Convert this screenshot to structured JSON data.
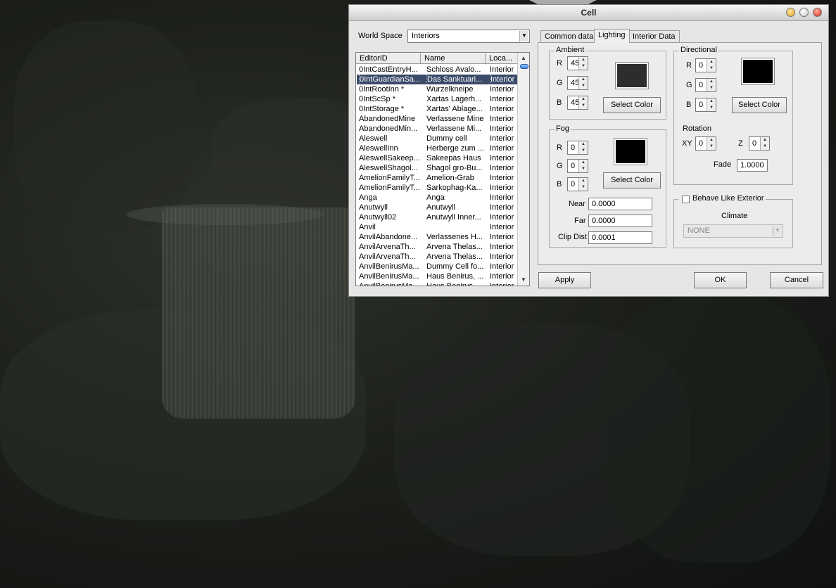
{
  "window": {
    "title": "Cell"
  },
  "worldspace": {
    "label": "World Space",
    "value": "Interiors"
  },
  "list": {
    "columns": [
      "EditorID",
      "Name",
      "Loca..."
    ],
    "rows": [
      [
        "0IntCastEntryH...",
        "Schloss Avalo...",
        "Interior"
      ],
      [
        "0IntGuardianSa...",
        "Das Sanktuari...",
        "Interior"
      ],
      [
        "0IntRootInn *",
        "Wurzelkneipe",
        "Interior"
      ],
      [
        "0IntScSp *",
        "Xartas Lagerh...",
        "Interior"
      ],
      [
        "0IntStorage *",
        "Xartas' Ablage...",
        "Interior"
      ],
      [
        "AbandonedMine",
        "Verlassene Mine",
        "Interior"
      ],
      [
        "AbandonedMin...",
        "Verlassene Mi...",
        "Interior"
      ],
      [
        "Aleswell",
        "Dummy cell",
        "Interior"
      ],
      [
        "AleswellInn",
        "Herberge zum ...",
        "Interior"
      ],
      [
        "AleswellSakeep...",
        "Sakeepas Haus",
        "Interior"
      ],
      [
        "AleswellShagol...",
        "Shagol gro-Bu...",
        "Interior"
      ],
      [
        "AmelionFamilyT...",
        "Amelion-Grab",
        "Interior"
      ],
      [
        "AmelionFamilyT...",
        "Sarkophag-Ka...",
        "Interior"
      ],
      [
        "Anga",
        "Anga",
        "Interior"
      ],
      [
        "Anutwyll",
        "Anutwyll",
        "Interior"
      ],
      [
        "Anutwyll02",
        "Anutwyll Inner...",
        "Interior"
      ],
      [
        "Anvil",
        "",
        "Interior"
      ],
      [
        "AnvilAbandone...",
        "Verlassenes H...",
        "Interior"
      ],
      [
        "AnvilArvenaTh...",
        "Arvena Thelas...",
        "Interior"
      ],
      [
        "AnvilArvenaTh...",
        "Arvena Thelas...",
        "Interior"
      ],
      [
        "AnvilBenirusMa...",
        "Dummy Cell fo...",
        "Interior"
      ],
      [
        "AnvilBenirusMa...",
        "Haus Benirus, ...",
        "Interior"
      ],
      [
        "AnvilBenirusMa...",
        "Haus Benirus, ...",
        "Interior"
      ]
    ],
    "selected_index": 1
  },
  "tabs": [
    "Common data",
    "Lighting",
    "Interior Data"
  ],
  "active_tab": "Lighting",
  "ambient": {
    "title": "Ambient",
    "r": "45",
    "g": "45",
    "b": "45",
    "color": "#2d2d2d",
    "button": "Select Color"
  },
  "fog": {
    "title": "Fog",
    "r": "0",
    "g": "0",
    "b": "0",
    "color": "#000000",
    "button": "Select Color",
    "near_label": "Near",
    "near": "0.0000",
    "far_label": "Far",
    "far": "0.0000",
    "clip_label": "Clip Dist",
    "clip": "0.0001"
  },
  "directional": {
    "title": "Directional",
    "r": "0",
    "g": "0",
    "b": "0",
    "color": "#000000",
    "button": "Select Color",
    "rotation_label": "Rotation",
    "xy_label": "XY",
    "xy": "0",
    "z_label": "Z",
    "z": "0",
    "fade_label": "Fade",
    "fade": "1.0000"
  },
  "exterior": {
    "label": "Behave Like Exterior",
    "checked": false,
    "climate_label": "Climate",
    "climate_value": "NONE"
  },
  "rgb_labels": {
    "r": "R",
    "g": "G",
    "b": "B"
  },
  "buttons": {
    "apply": "Apply",
    "ok": "OK",
    "cancel": "Cancel"
  }
}
